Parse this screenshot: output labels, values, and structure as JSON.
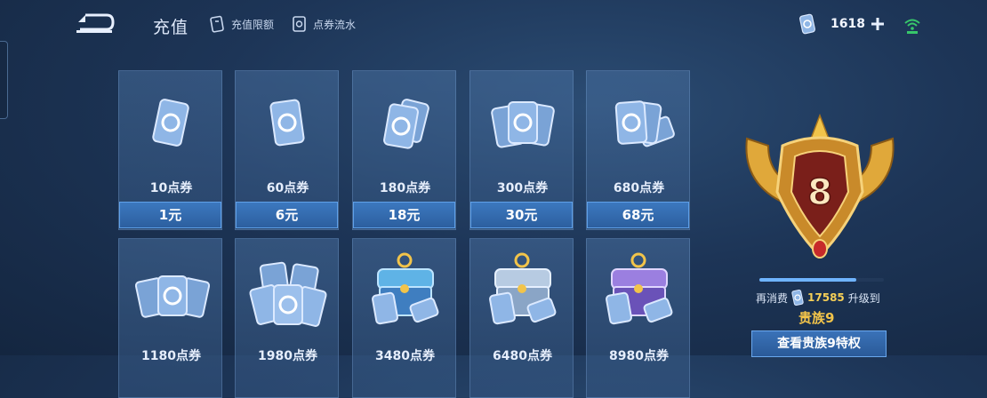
{
  "header": {
    "title": "充值",
    "nav": [
      {
        "label": "充值限额",
        "icon": "voucher-limit-icon"
      },
      {
        "label": "点券流水",
        "icon": "voucher-flow-icon"
      }
    ],
    "balance": "1618",
    "icons": {
      "back": "back-arrow-icon",
      "currency": "voucher-icon",
      "add": "plus-icon",
      "signal": "wifi-signal-icon"
    }
  },
  "products": [
    {
      "vouchers": "10点券",
      "price": "1元",
      "art": "single-card"
    },
    {
      "vouchers": "60点券",
      "price": "6元",
      "art": "single-card"
    },
    {
      "vouchers": "180点券",
      "price": "18元",
      "art": "double-card"
    },
    {
      "vouchers": "300点券",
      "price": "30元",
      "art": "triple-card"
    },
    {
      "vouchers": "680点券",
      "price": "68元",
      "art": "triple-card"
    },
    {
      "vouchers": "1180点券",
      "price": "",
      "art": "card-stack"
    },
    {
      "vouchers": "1980点券",
      "price": "",
      "art": "card-pile"
    },
    {
      "vouchers": "3480点券",
      "price": "",
      "art": "blue-chest"
    },
    {
      "vouchers": "6480点券",
      "price": "",
      "art": "silver-chest"
    },
    {
      "vouchers": "8980点券",
      "price": "",
      "art": "purple-chest"
    }
  ],
  "noble": {
    "badge_level": "8",
    "progress": 0.78,
    "spend_prefix": "再消费",
    "spend_amount": "17585",
    "spend_suffix": "升级到",
    "next_level": "贵族9",
    "view_button": "查看贵族9特权"
  },
  "colors": {
    "accent_gold": "#f2c44a",
    "button_blue": "#3c78bf",
    "background": "#1d3557"
  }
}
